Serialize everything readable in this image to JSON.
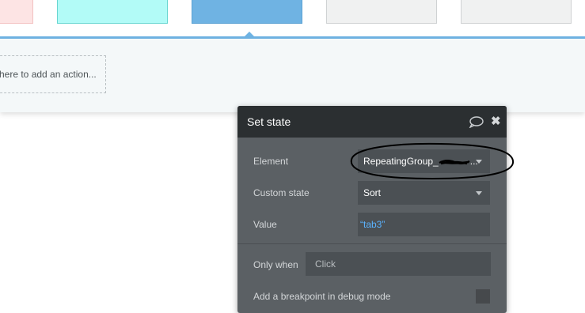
{
  "workflow": {
    "add_action_text": "here to add an action..."
  },
  "dialog": {
    "title": "Set state",
    "element_label": "Element",
    "element_value": "RepeatingGroup_",
    "element_value_suffix": "...",
    "custom_state_label": "Custom state",
    "custom_state_value": "Sort",
    "value_label": "Value",
    "value_value": "“tab3”",
    "only_when_label": "Only when",
    "only_when_placeholder": "Click",
    "breakpoint_label": "Add a breakpoint in debug mode"
  },
  "colors": {
    "accent": "#6fb3e3",
    "dialog_bg": "#5b6064",
    "dialog_header": "#2b2f31",
    "value_blue": "#5ab3ff"
  },
  "icons": [
    "comment-icon",
    "close-icon",
    "chevron-down-icon"
  ]
}
